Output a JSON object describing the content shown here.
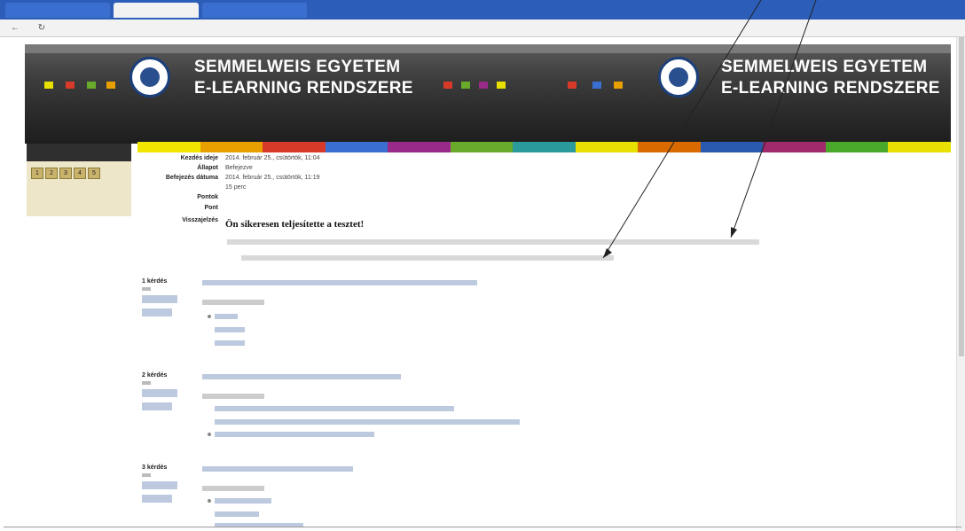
{
  "browser": {
    "tabs": [
      "",
      "",
      ""
    ]
  },
  "banner": {
    "title_line1": "SEMMELWEIS EGYETEM",
    "title_line2": "E-LEARNING RENDSZERE",
    "login_text": ""
  },
  "breadcrumb": "",
  "sidebar": {
    "heading": "",
    "question_numbers": [
      "1",
      "2",
      "3",
      "4",
      "5"
    ]
  },
  "summary": {
    "rows": [
      {
        "label": "Kezdés ideje",
        "value": "2014. február 25., csütörtök, 11:04"
      },
      {
        "label": "Állapot",
        "value": "Befejezve"
      },
      {
        "label": "Befejezés dátuma",
        "value": "2014. február 25., csütörtök, 11:19"
      },
      {
        "label": "",
        "value": "15 perc"
      },
      {
        "label": "Pontok",
        "value": ""
      },
      {
        "label": "Pont",
        "value": ""
      },
      {
        "label": "Visszajelzés",
        "value": ""
      }
    ],
    "feedback_title": "Ön sikeresen teljesítette a tesztet!"
  },
  "questions": [
    {
      "title": "1 kérdés",
      "prompt": "",
      "answers": [
        "",
        "",
        ""
      ]
    },
    {
      "title": "2 kérdés",
      "prompt": "",
      "answers": [
        "",
        "",
        ""
      ]
    },
    {
      "title": "3 kérdés",
      "prompt": "",
      "answers": [
        "",
        "",
        ""
      ]
    }
  ],
  "colors": {
    "banner_dark": "#2a2a2a",
    "tabbar_blue": "#2c5db8",
    "sidebar_bg": "#ede6c8",
    "link_blue": "#3a5f9a",
    "strip": [
      "#f2e600",
      "#e8a000",
      "#d83a2a",
      "#3a6fd0",
      "#9a2a8a",
      "#6aaa2a",
      "#2a9a9a",
      "#e8e000",
      "#d86a00",
      "#2a5ab0",
      "#a02a6a",
      "#4aa82a",
      "#e8e000"
    ]
  }
}
